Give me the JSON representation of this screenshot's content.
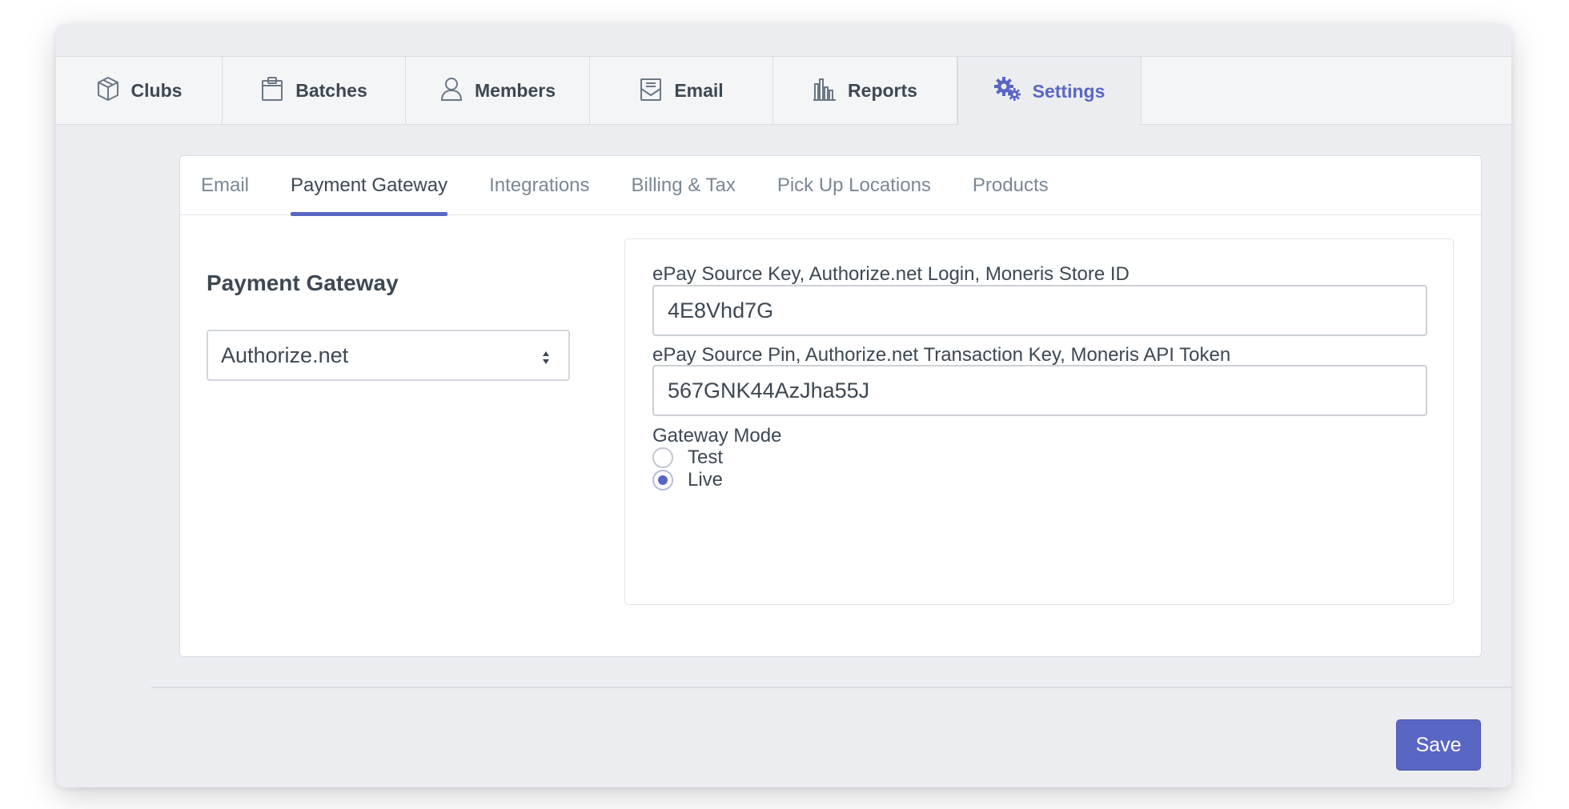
{
  "nav": {
    "items": [
      {
        "label": "Clubs",
        "icon": "cube-icon"
      },
      {
        "label": "Batches",
        "icon": "clipboard-icon"
      },
      {
        "label": "Members",
        "icon": "user-icon"
      },
      {
        "label": "Email",
        "icon": "envelope-icon"
      },
      {
        "label": "Reports",
        "icon": "bar-chart-icon"
      },
      {
        "label": "Settings",
        "icon": "gears-icon",
        "active": true
      }
    ]
  },
  "subtabs": {
    "items": [
      "Email",
      "Payment Gateway",
      "Integrations",
      "Billing & Tax",
      "Pick Up Locations",
      "Products"
    ],
    "active": "Payment Gateway"
  },
  "gateway": {
    "title": "Payment Gateway",
    "selected": "Authorize.net"
  },
  "form": {
    "source_key_label": "ePay Source Key, Authorize.net Login, Moneris Store ID",
    "source_key_value": "4E8Vhd7G",
    "source_pin_label": "ePay Source Pin, Authorize.net Transaction Key, Moneris API Token",
    "source_pin_value": "567GNK44AzJha55J",
    "mode_label": "Gateway Mode",
    "mode_options": [
      "Test",
      "Live"
    ],
    "mode_selected": "Live"
  },
  "footer": {
    "save_label": "Save"
  },
  "colors": {
    "accent": "#5a66c4",
    "background": "#ebedf0",
    "text": "#3d4852",
    "muted": "#7b8794"
  }
}
